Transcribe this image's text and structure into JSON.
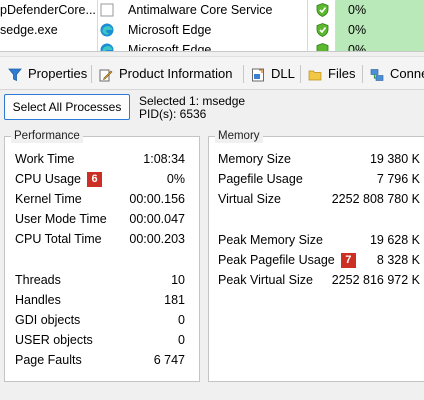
{
  "processes": [
    {
      "name": "pDefenderCore...",
      "description": "Antimalware Core Service",
      "cpu": "0%"
    },
    {
      "name": "sedge.exe",
      "description": "Microsoft Edge",
      "cpu": "0%"
    },
    {
      "name": "",
      "description": "Microsoft Edge",
      "cpu": "0%"
    }
  ],
  "toolbar": {
    "properties": "Properties",
    "product_information": "Product Information",
    "dll": "DLL",
    "files": "Files",
    "connections": "Conne"
  },
  "selection": {
    "button": "Select All Processes",
    "selected": "Selected 1: msedge",
    "pids": "PID(s): 6536"
  },
  "performance": {
    "title": "Performance",
    "rows": [
      {
        "label": "Work Time",
        "value": "1:08:34"
      },
      {
        "label": "CPU Usage",
        "value": "0%",
        "badge": "6"
      },
      {
        "label": "Kernel Time",
        "value": "00:00.156"
      },
      {
        "label": "User Mode Time",
        "value": "00:00.047"
      },
      {
        "label": "CPU Total Time",
        "value": "00:00.203"
      },
      {
        "label": "Threads",
        "value": "10"
      },
      {
        "label": "Handles",
        "value": "181"
      },
      {
        "label": "GDI objects",
        "value": "0"
      },
      {
        "label": "USER objects",
        "value": "0"
      },
      {
        "label": "Page Faults",
        "value": "6 747"
      }
    ]
  },
  "memory": {
    "title": "Memory",
    "rows": [
      {
        "label": "Memory Size",
        "value": "19 380 K"
      },
      {
        "label": "Pagefile Usage",
        "value": "7 796 K"
      },
      {
        "label": "Virtual Size",
        "value": "2252 808 780 K"
      },
      {
        "label": "Peak Memory Size",
        "value": "19 628 K"
      },
      {
        "label": "Peak Pagefile Usage",
        "value": "8 328 K",
        "badge": "7"
      },
      {
        "label": "Peak Virtual Size",
        "value": "2252 816 972 K"
      }
    ]
  },
  "colors": {
    "cpu_highlight": "#b9e9b9",
    "badge": "#cc2f24",
    "selection_border": "#2a7ad6"
  }
}
